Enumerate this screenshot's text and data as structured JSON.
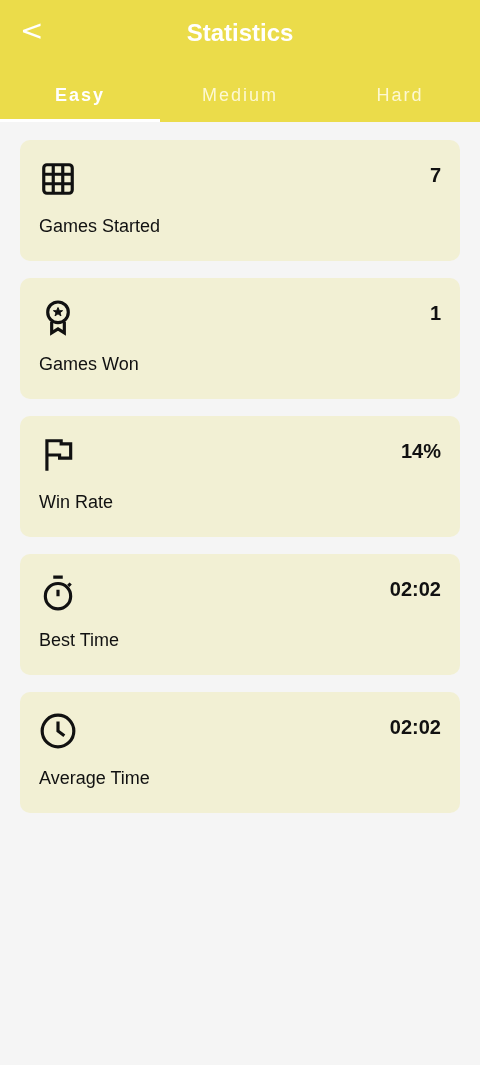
{
  "header": {
    "back": "<",
    "title": "Statistics"
  },
  "tabs": [
    {
      "label": "Easy",
      "selected": true
    },
    {
      "label": "Medium",
      "selected": false
    },
    {
      "label": "Hard",
      "selected": false
    }
  ],
  "stats": [
    {
      "kind": "grid",
      "label": "Games Started",
      "value": "7"
    },
    {
      "kind": "award",
      "label": "Games Won",
      "value": "1"
    },
    {
      "kind": "flag",
      "label": "Win Rate",
      "value": "14%"
    },
    {
      "kind": "stopwatch",
      "label": "Best Time",
      "value": "02:02"
    },
    {
      "kind": "clock",
      "label": "Average Time",
      "value": "02:02"
    }
  ]
}
